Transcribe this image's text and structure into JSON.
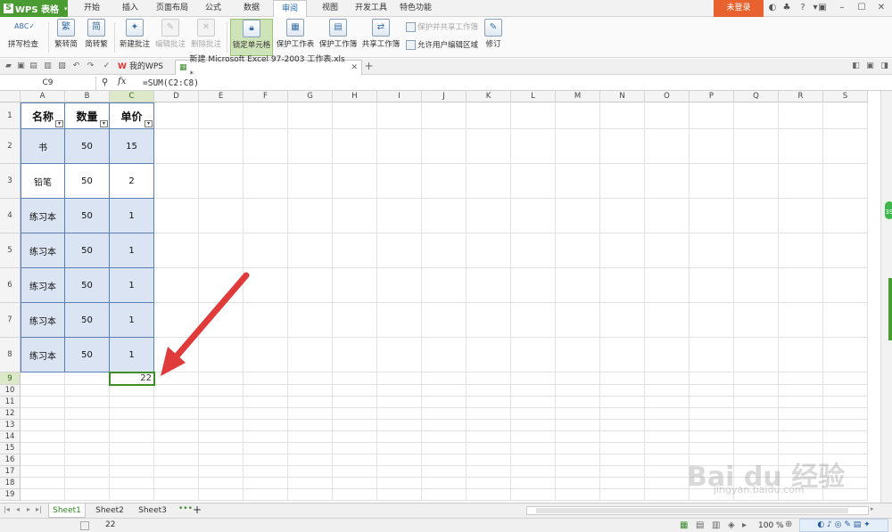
{
  "app": {
    "brand": "WPS 表格",
    "login": "未登录"
  },
  "menu": [
    "开始",
    "插入",
    "页面布局",
    "公式",
    "数据",
    "审阅",
    "视图",
    "开发工具",
    "特色功能"
  ],
  "menu_active": "审阅",
  "ribbon": {
    "spell": "拼写检查",
    "trad": "繁转简",
    "simp": "简转繁",
    "new_comment": "新建批注",
    "edit_comment": "编辑批注",
    "delete_comment": "删除批注",
    "lock_cell": "锁定单元格",
    "protect_sheet": "保护工作表",
    "protect_book": "保护工作簿",
    "share_book": "共享工作簿",
    "protect_share": "保护并共享工作簿",
    "allow_edit": "允许用户编辑区域",
    "revise": "修订"
  },
  "doctabs": {
    "mywps": "我的WPS",
    "file": "新建 Microsoft Excel 97-2003 工作表.xls *"
  },
  "formula_bar": {
    "cell_ref": "C9",
    "fx": "fx",
    "formula": "=SUM(C2:C8)"
  },
  "columns": [
    "A",
    "B",
    "C",
    "D",
    "E",
    "F",
    "G",
    "H",
    "I",
    "J",
    "K",
    "L",
    "M",
    "N",
    "O",
    "P",
    "Q",
    "R",
    "S"
  ],
  "rows": [
    "1",
    "2",
    "3",
    "4",
    "5",
    "6",
    "7",
    "8",
    "9",
    "10",
    "11",
    "12",
    "13",
    "14",
    "15",
    "16",
    "17",
    "18",
    "19"
  ],
  "table": {
    "headers": [
      "名称",
      "数量",
      "单价"
    ],
    "data": [
      [
        "书",
        "50",
        "15"
      ],
      [
        "铅笔",
        "50",
        "2"
      ],
      [
        "练习本",
        "50",
        "1"
      ],
      [
        "练习本",
        "50",
        "1"
      ],
      [
        "练习本",
        "50",
        "1"
      ],
      [
        "练习本",
        "50",
        "1"
      ],
      [
        "练习本",
        "50",
        "1"
      ]
    ],
    "sum": "22"
  },
  "sheets": [
    "Sheet1",
    "Sheet2",
    "Sheet3"
  ],
  "active_sheet": "Sheet1",
  "status": {
    "value": "22",
    "zoom": "100 %"
  },
  "side_badge": "39",
  "watermark": {
    "main": "Bai du 经验",
    "sub": "jingyan.baidu.com"
  },
  "colors": {
    "brand": "#4a9b31",
    "login": "#e8622f",
    "table_fill": "#dbe4f2",
    "arrow": "#e03a3a"
  }
}
